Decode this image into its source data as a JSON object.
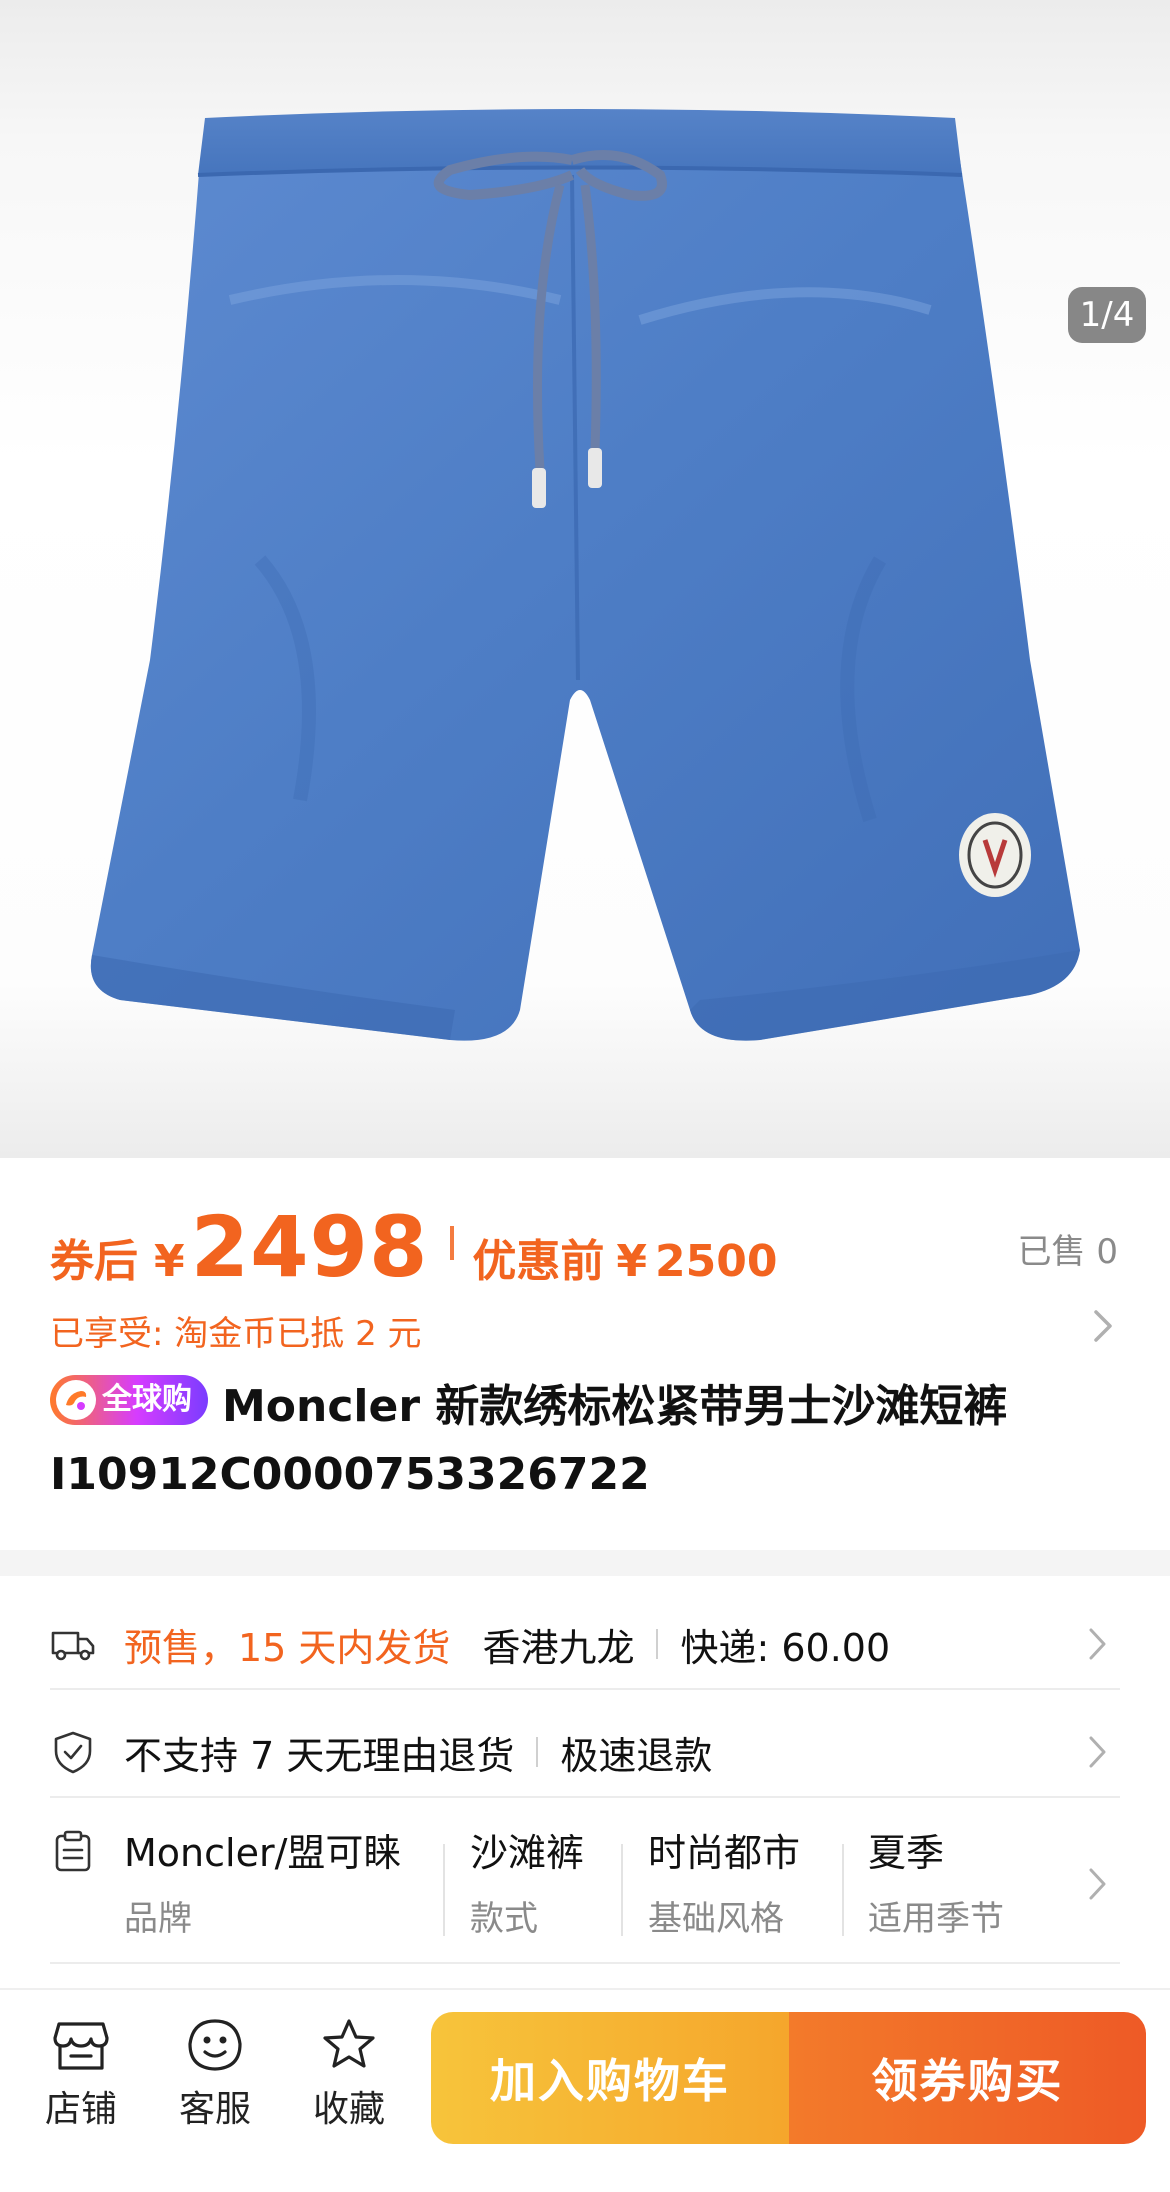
{
  "product_image": {
    "counter": "1/4"
  },
  "price": {
    "prefix": "券后",
    "currency": "¥",
    "amount": "2498",
    "original_label": "优惠前",
    "original_currency": "¥",
    "original_amount": "2500",
    "sold": "已售 0"
  },
  "coin_discount": "已享受: 淘金币已抵 2 元",
  "title": {
    "badge": "全球购",
    "text": "Moncler 新款绣标松紧带男士沙滩短裤 I10912C0000753326722"
  },
  "shipping": {
    "presale": "预售，15 天内发货",
    "origin": "香港九龙",
    "express": "快递: 60.00"
  },
  "returns": {
    "policy": "不支持 7 天无理由退货",
    "refund": "极速退款"
  },
  "attributes": [
    {
      "value": "Moncler/盟可睐",
      "key": "品牌"
    },
    {
      "value": "沙滩裤",
      "key": "款式"
    },
    {
      "value": "时尚都市",
      "key": "基础风格"
    },
    {
      "value": "夏季",
      "key": "适用季节"
    }
  ],
  "bottom_bar": {
    "store": "店铺",
    "service": "客服",
    "favorite": "收藏",
    "add_to_cart": "加入购物车",
    "buy_with_coupon": "领券购买"
  },
  "colors": {
    "accent": "#f2641f",
    "cart_button": "#f5b033",
    "buy_button": "#ef6027",
    "product": "#4f7fc4"
  },
  "icons": [
    "truck-icon",
    "shield-check-icon",
    "clipboard-icon",
    "store-icon",
    "smiley-icon",
    "star-icon",
    "chevron-right-icon"
  ]
}
